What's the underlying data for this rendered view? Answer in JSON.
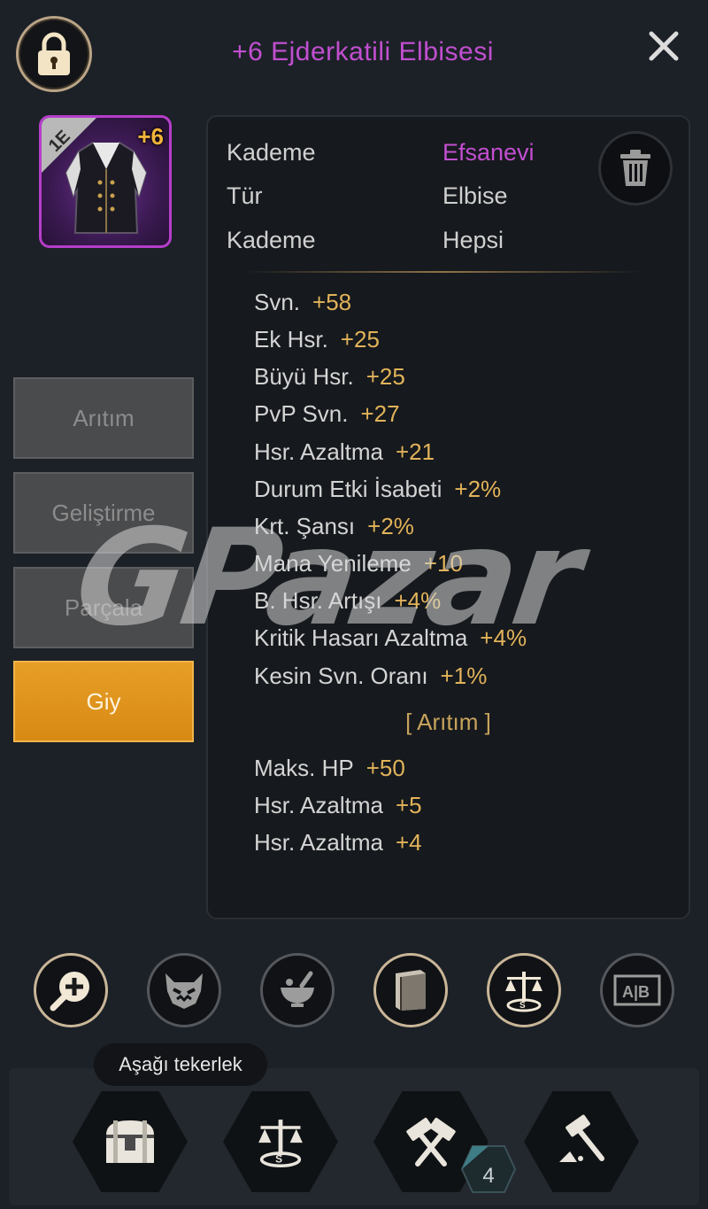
{
  "header": {
    "title": "+6 Ejderkatili Elbisesi",
    "lock_icon": "lock-icon",
    "close_icon": "close-icon"
  },
  "item": {
    "plus": "+6",
    "grade_badge": "1E"
  },
  "side_buttons": [
    {
      "label": "Arıtım"
    },
    {
      "label": "Geliştirme"
    },
    {
      "label": "Parçala"
    },
    {
      "label": "Giy"
    }
  ],
  "info": {
    "rows": [
      {
        "label": "Kademe",
        "value": "Efsanevi"
      },
      {
        "label": "Tür",
        "value": "Elbise"
      },
      {
        "label": "Kademe",
        "value": "Hepsi"
      }
    ]
  },
  "stats": [
    {
      "name": "Svn.",
      "value": "+58"
    },
    {
      "name": "Ek Hsr.",
      "value": "+25"
    },
    {
      "name": "Büyü Hsr.",
      "value": "+25"
    },
    {
      "name": "PvP Svn.",
      "value": "+27"
    },
    {
      "name": "Hsr. Azaltma",
      "value": "+21"
    },
    {
      "name": "Durum Etki İsabeti",
      "value": "+2%"
    },
    {
      "name": "Krt. Şansı",
      "value": "+2%"
    },
    {
      "name": "Mana Yenileme",
      "value": "+10"
    },
    {
      "name": "B. Hsr. Artışı",
      "value": "+4%"
    },
    {
      "name": "Kritik Hasarı Azaltma",
      "value": "+4%"
    },
    {
      "name": "Kesin Svn. Oranı",
      "value": "+1%"
    }
  ],
  "refine": {
    "title": "[ Arıtım ]",
    "stats": [
      {
        "name": "Maks. HP",
        "value": "+50"
      },
      {
        "name": "Hsr. Azaltma",
        "value": "+5"
      },
      {
        "name": "Hsr. Azaltma",
        "value": "+4"
      }
    ]
  },
  "watermark": "GPazar",
  "action_icons": [
    "magnify-plus-icon",
    "demon-mask-icon",
    "mortar-bowl-icon",
    "book-icon",
    "scales-icon",
    "compare-ab-icon"
  ],
  "compare_text": "A|B",
  "bottom": {
    "tooltip": "Aşağı tekerlek",
    "icons": [
      "chest-icon",
      "scales-icon",
      "hammers-icon",
      "hammer-smash-icon"
    ],
    "badge_count": "4"
  },
  "colors": {
    "background": "#1c2127",
    "legendary": "#c14fd0",
    "stat_value": "#e1b35a",
    "active_button": "#df9420"
  }
}
